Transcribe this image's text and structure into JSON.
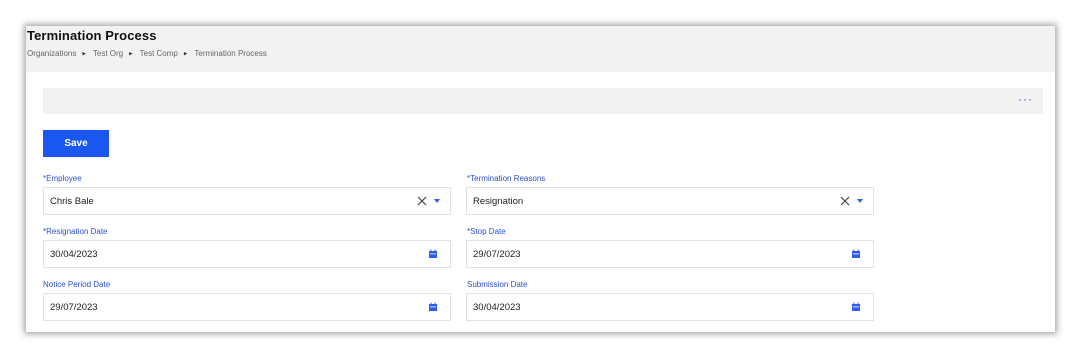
{
  "header": {
    "title": "Termination Process",
    "breadcrumb": [
      "Organizations",
      "Test Org",
      "Test Comp",
      "Termination Process"
    ]
  },
  "toolbar": {
    "more_label": "···"
  },
  "actions": {
    "save_label": "Save"
  },
  "form": {
    "employee": {
      "label": "*Employee",
      "value": "Chris Bale"
    },
    "termination_reasons": {
      "label": "*Termination Reasons",
      "value": "Resignation"
    },
    "resignation_date": {
      "label": "*Resignation Date",
      "value": "30/04/2023"
    },
    "stop_date": {
      "label": "*Stop Date",
      "value": "29/07/2023"
    },
    "notice_period_date": {
      "label": "Notice Period Date",
      "value": "29/07/2023"
    },
    "submission_date": {
      "label": "Submission Date",
      "value": "30/04/2023"
    }
  },
  "colors": {
    "accent": "#1a57f0",
    "label": "#2b4fd3",
    "header_bg": "#f2f2f2"
  },
  "icons": {
    "clear": "close-icon",
    "dropdown": "chevron-down-icon",
    "date": "calendar-icon",
    "breadcrumb_sep": "chevron-right-icon"
  }
}
